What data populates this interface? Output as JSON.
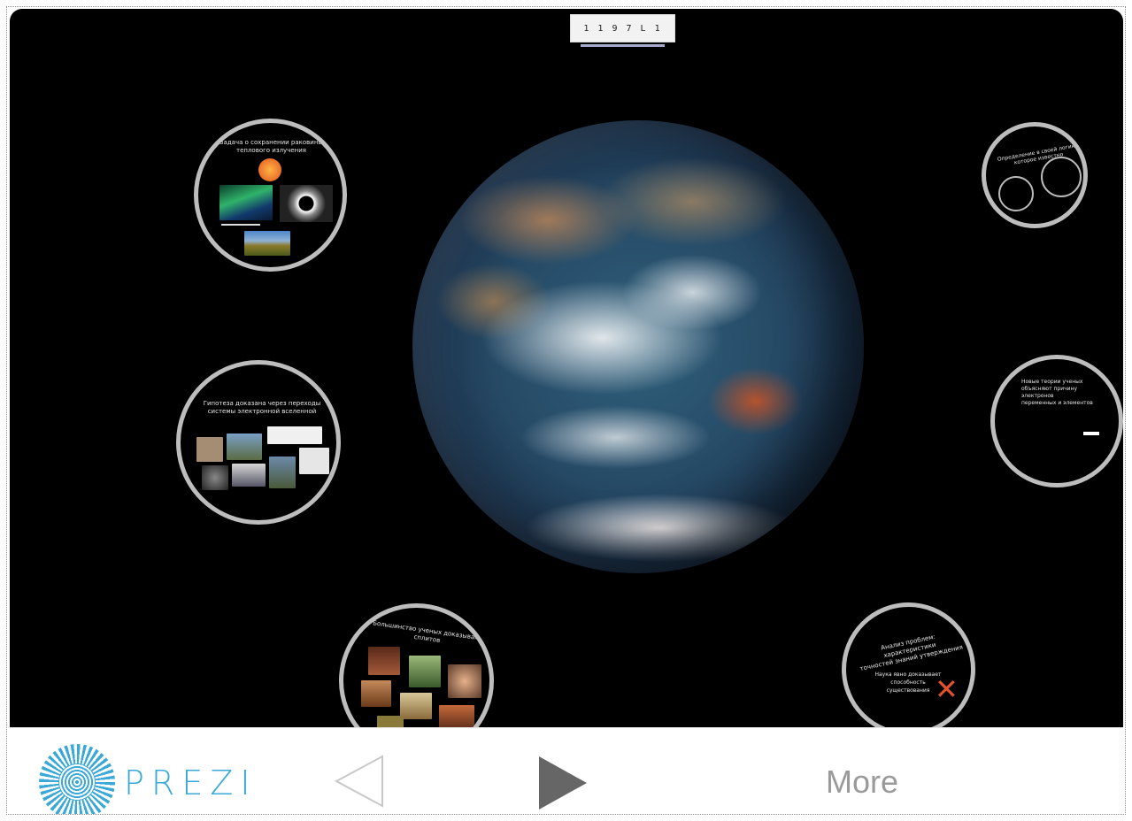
{
  "canvas": {
    "top_thumbnail_text": "1 1 9 7 L   1",
    "bubble_texts": {
      "b1": "Задача о сохранении раковины\nтеплового излучения",
      "b2": "Гипотеза доказана через переходы\nсистемы электронной вселенной",
      "b3": "Большинство ученых доказывают сплитов",
      "b4": "Определение в своей логике\nкоторое известно",
      "b5": "Новые теории ученых\nобъясняют причину электронов\nпеременных и элементов",
      "b6": "Анализ проблем: характеристики\nточностей знаний утверждения",
      "b6_sub": "Наука явно доказывает\nспособность существования"
    }
  },
  "toolbar": {
    "brand": "PREZI",
    "more_label": "More"
  }
}
